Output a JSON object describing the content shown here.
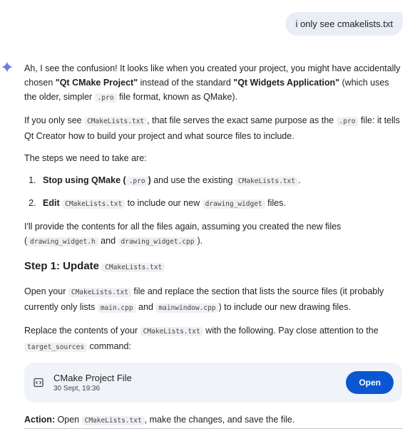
{
  "user_message": "i only see cmakelists.txt",
  "response": {
    "p1": {
      "t1": "Ah, I see the confusion! It looks like when you created your project, you might have accidentally chosen ",
      "b1": "\"Qt CMake Project\"",
      "t2": " instead of the standard ",
      "b2": "\"Qt Widgets Application\"",
      "t3": " (which uses the older, simpler ",
      "c1": ".pro",
      "t4": " file format, known as QMake)."
    },
    "p2": {
      "t1": "If you only see ",
      "c1": "CMakeLists.txt",
      "t2": ", that file serves the exact same purpose as the ",
      "c2": ".pro",
      "t3": " file: it tells Qt Creator how to build your project and what source files to include."
    },
    "p3": "The steps we need to take are:",
    "steps": [
      {
        "b": "Stop using QMake (",
        "c1": ".pro",
        "b2": ")",
        "t": " and use the existing ",
        "c2": "CMakeLists.txt",
        "t2": "."
      },
      {
        "b": "Edit",
        "c1": "CMakeLists.txt",
        "t": " to include our new ",
        "c2": "drawing_widget",
        "t2": " files."
      }
    ],
    "p4": {
      "t1": "I'll provide the contents for all the files again, assuming you created the new files (",
      "c1": "drawing_widget.h",
      "t2": " and ",
      "c2": "drawing_widget.cpp",
      "t3": ")."
    },
    "heading": {
      "text": "Step 1: Update",
      "code": "CMakeLists.txt"
    },
    "p5": {
      "t1": "Open your ",
      "c1": "CMakeLists.txt",
      "t2": " file and replace the section that lists the source files (it probably currently only lists ",
      "c2": "main.cpp",
      "t3": " and ",
      "c3": "mainwindow.cpp",
      "t4": ") to include our new drawing files."
    },
    "p6": {
      "t1": "Replace the contents of your ",
      "c1": "CMakeLists.txt",
      "t2": " with the following. Pay close attention to the ",
      "c2": "target_sources",
      "t3": " command:"
    },
    "card": {
      "title": "CMake Project File",
      "date": "30 Sept, 19:36",
      "button": "Open",
      "icon": "code-file-icon"
    },
    "p7": {
      "b": "Action:",
      "t1": " Open ",
      "c1": "CMakeLists.txt",
      "t2": ", make the changes, and save the file."
    }
  },
  "colors": {
    "user_bubble": "#e9eef6",
    "card_bg": "#f0f4f9",
    "button": "#0b57d0",
    "gemini_gradient": [
      "#4285f4",
      "#9b72cb"
    ]
  }
}
